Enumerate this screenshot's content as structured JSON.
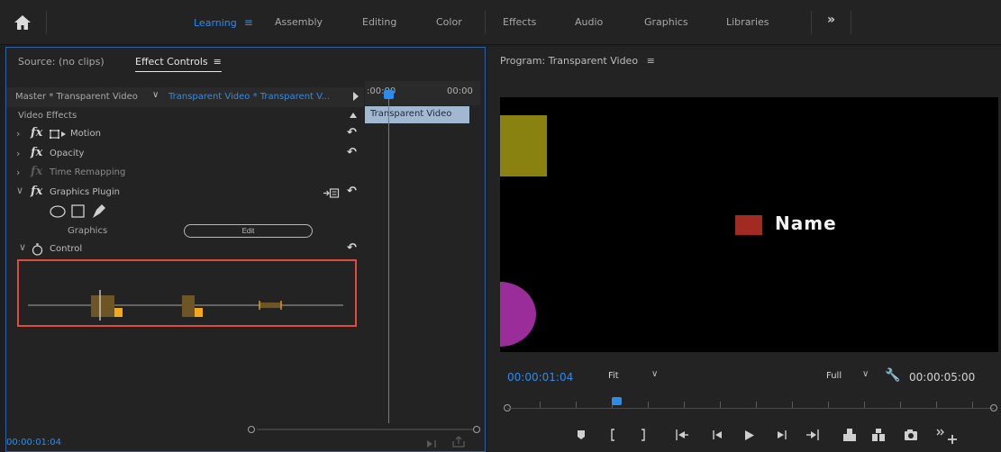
{
  "workspace": {
    "home_icon": "home-icon",
    "tabs": [
      {
        "label": "Learning",
        "active": true
      },
      {
        "label": "Assembly"
      },
      {
        "label": "Editing"
      },
      {
        "label": "Color"
      },
      {
        "label": "Effects"
      },
      {
        "label": "Audio"
      },
      {
        "label": "Graphics"
      },
      {
        "label": "Libraries"
      }
    ],
    "overflow": "»"
  },
  "left_panel": {
    "tab_source": "Source: (no clips)",
    "tab_effect_controls": "Effect Controls",
    "menu_glyph": "≡",
    "master_label": "Master * Transparent Video",
    "clip_label": "Transparent Video * Transparent V...",
    "video_effects_label": "Video Effects",
    "effects": [
      {
        "name": "Motion",
        "has_motion_icon": true
      },
      {
        "name": "Opacity"
      },
      {
        "name": "Time Remapping",
        "dim": true
      },
      {
        "name": "Graphics Plugin",
        "expanded": true
      }
    ],
    "graphics_label": "Graphics",
    "edit_button": "Edit",
    "control_label": "Control",
    "timeline": {
      "ruler_start": ":00:00",
      "ruler_end": "00:00",
      "clip_name": "Transparent Video"
    },
    "bottom_timecode": "00:00:01:04"
  },
  "program_monitor": {
    "title": "Program: Transparent Video",
    "menu_glyph": "≡",
    "name_text": "Name",
    "current_timecode": "00:00:01:04",
    "fit_label": "Fit",
    "resolution_label": "Full",
    "duration": "00:00:05:00",
    "transport": [
      "marker-icon",
      "in-point-icon",
      "out-point-icon",
      "go-to-in-icon",
      "step-back-icon",
      "play-icon",
      "step-forward-icon",
      "go-to-out-icon",
      "lift-icon",
      "extract-icon",
      "export-frame-icon",
      "more-icon",
      "add-icon"
    ]
  },
  "colors": {
    "accent_blue": "#2d8ceb",
    "highlight_red": "#e04b3f",
    "olive": "#8a8210",
    "purple": "#9a2d9a",
    "name_box": "#a12a22",
    "keyframe_orange": "#f4a81a",
    "keyframe_brown": "#6e5525"
  }
}
